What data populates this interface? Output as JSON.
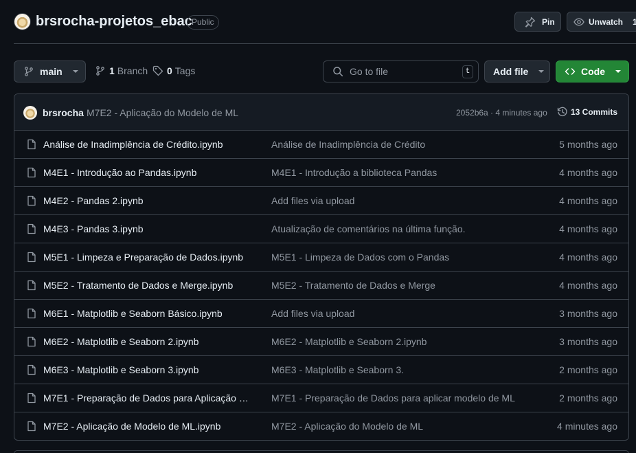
{
  "repo": {
    "name": "brsrocha-projetos_ebac",
    "visibility": "Public",
    "pin_label": "Pin",
    "unwatch_label": "Unwatch",
    "watch_count": "1"
  },
  "toolbar": {
    "branch": "main",
    "branch_count": "1",
    "branch_label": "Branch",
    "tag_count": "0",
    "tag_label": "Tags",
    "search_placeholder": "Go to file",
    "search_shortcut": "t",
    "add_file_label": "Add file",
    "code_label": "Code"
  },
  "latest_commit": {
    "author": "brsrocha",
    "message": "M7E2 - Aplicação do Modelo de ML",
    "meta": "2052b6a · 4 minutes ago",
    "commits_label": "13 Commits"
  },
  "files": [
    {
      "name": "Análise de Inadimplência de Crédito.ipynb",
      "message": "Análise de Inadimplência de Crédito",
      "date": "5 months ago"
    },
    {
      "name": "M4E1 - Introdução ao Pandas.ipynb",
      "message": "M4E1 - Introdução a biblioteca Pandas",
      "date": "4 months ago"
    },
    {
      "name": "M4E2 - Pandas 2.ipynb",
      "message": "Add files via upload",
      "date": "4 months ago"
    },
    {
      "name": "M4E3 - Pandas 3.ipynb",
      "message": "Atualização de comentários na última função.",
      "date": "4 months ago"
    },
    {
      "name": "M5E1 - Limpeza e Preparação de Dados.ipynb",
      "message": "M5E1 - Limpeza de Dados com o Pandas",
      "date": "4 months ago"
    },
    {
      "name": "M5E2 - Tratamento de Dados e Merge.ipynb",
      "message": "M5E2 - Tratamento de Dados e Merge",
      "date": "4 months ago"
    },
    {
      "name": "M6E1 - Matplotlib e Seaborn Básico.ipynb",
      "message": "Add files via upload",
      "date": "3 months ago"
    },
    {
      "name": "M6E2 - Matplotlib e Seaborn 2.ipynb",
      "message": "M6E2 - Matplotlib e Seaborn 2.ipynb",
      "date": "3 months ago"
    },
    {
      "name": "M6E3 - Matplotlib e Seaborn 3.ipynb",
      "message": "M6E3 - Matplotlib e Seaborn 3.",
      "date": "2 months ago"
    },
    {
      "name": "M7E1 - Preparação de Dados para Aplicação d...",
      "message": "M7E1 - Preparação de Dados para aplicar modelo de ML",
      "date": "2 months ago"
    },
    {
      "name": "M7E2 - Aplicação de Modelo de ML.ipynb",
      "message": "M7E2 - Aplicação do Modelo de ML",
      "date": "4 minutes ago"
    }
  ]
}
